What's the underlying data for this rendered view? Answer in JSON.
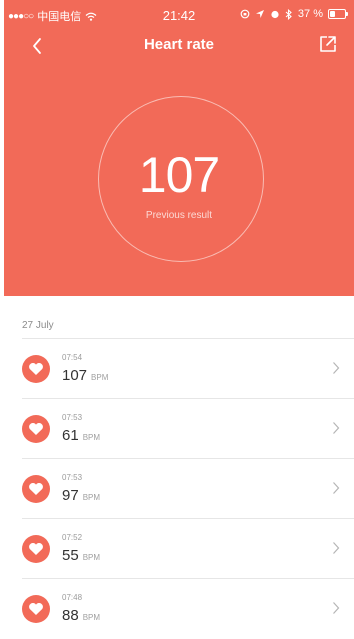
{
  "status_bar": {
    "carrier": "中国电信",
    "time": "21:42",
    "battery": "37 %"
  },
  "header": {
    "title": "Heart rate",
    "back_icon": "chevron-left-icon",
    "share_icon": "share-external-icon",
    "accent_color": "#f26a58",
    "current_value": "107",
    "current_label": "Previous result"
  },
  "history": {
    "date": "27 July",
    "unit": "BPM",
    "items": [
      {
        "time": "07:54",
        "value": "107"
      },
      {
        "time": "07:53",
        "value": "61"
      },
      {
        "time": "07:53",
        "value": "97"
      },
      {
        "time": "07:52",
        "value": "55"
      },
      {
        "time": "07:48",
        "value": "88"
      }
    ]
  }
}
